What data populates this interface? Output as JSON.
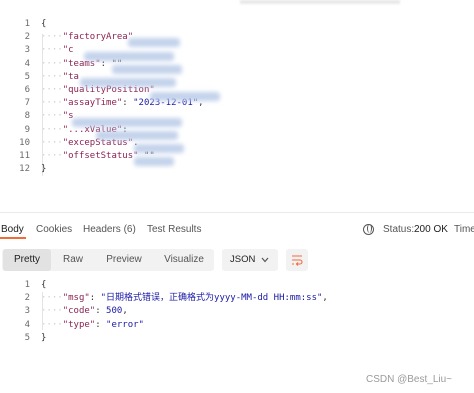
{
  "request": {
    "line_numbers": [
      "1",
      "2",
      "3",
      "4",
      "5",
      "6",
      "7",
      "8",
      "9",
      "10",
      "11",
      "12"
    ],
    "lines": [
      {
        "parts": [
          {
            "t": "p",
            "v": "{"
          }
        ]
      },
      {
        "parts": [
          {
            "t": "k",
            "v": "\"factoryArea\""
          }
        ]
      },
      {
        "parts": [
          {
            "t": "k",
            "v": "\"c"
          }
        ]
      },
      {
        "parts": [
          {
            "t": "k",
            "v": "\"teams\""
          },
          {
            "t": "p",
            "v": ": \"\""
          }
        ]
      },
      {
        "parts": [
          {
            "t": "k",
            "v": "\"ta"
          }
        ]
      },
      {
        "parts": [
          {
            "t": "k",
            "v": "\"qualityPosition\""
          }
        ]
      },
      {
        "parts": [
          {
            "t": "k",
            "v": "\"assayTime\""
          },
          {
            "t": "p",
            "v": ": "
          },
          {
            "t": "s",
            "v": "\"2023-12-01\""
          },
          {
            "t": "p",
            "v": ","
          }
        ]
      },
      {
        "parts": [
          {
            "t": "k",
            "v": "\"s"
          }
        ]
      },
      {
        "parts": [
          {
            "t": "k",
            "v": "\"...xValue\""
          },
          {
            "t": "p",
            "v": ": "
          }
        ]
      },
      {
        "parts": [
          {
            "t": "k",
            "v": "\"excepStatus\""
          },
          {
            "t": "p",
            "v": "."
          }
        ]
      },
      {
        "parts": [
          {
            "t": "k",
            "v": "\"offsetStatus\""
          },
          {
            "t": "p",
            "v": " \"\""
          }
        ]
      },
      {
        "parts": [
          {
            "t": "p",
            "v": "}"
          }
        ]
      }
    ]
  },
  "tabs": {
    "body": "Body",
    "cookies": "Cookies",
    "headers": "Headers",
    "headers_count": "(6)",
    "test_results": "Test Results"
  },
  "status": {
    "label": "Status:",
    "value": "200 OK",
    "time_label": "Time"
  },
  "toolbar": {
    "pretty": "Pretty",
    "raw": "Raw",
    "preview": "Preview",
    "visualize": "Visualize",
    "format": "JSON"
  },
  "response": {
    "line_numbers": [
      "1",
      "2",
      "3",
      "4",
      "5"
    ],
    "lines": [
      {
        "parts": [
          {
            "t": "p",
            "v": "{"
          }
        ]
      },
      {
        "parts": [
          {
            "t": "k",
            "v": "\"msg\""
          },
          {
            "t": "p",
            "v": ": "
          },
          {
            "t": "s",
            "v": "\"日期格式错误，正确格式为yyyy-MM-dd HH:mm:ss\""
          },
          {
            "t": "p",
            "v": ","
          }
        ]
      },
      {
        "parts": [
          {
            "t": "k",
            "v": "\"code\""
          },
          {
            "t": "p",
            "v": ": "
          },
          {
            "t": "s",
            "v": "500"
          },
          {
            "t": "p",
            "v": ","
          }
        ]
      },
      {
        "parts": [
          {
            "t": "k",
            "v": "\"type\""
          },
          {
            "t": "p",
            "v": ": "
          },
          {
            "t": "s",
            "v": "\"error\""
          }
        ]
      },
      {
        "parts": [
          {
            "t": "p",
            "v": "}"
          }
        ]
      }
    ]
  },
  "watermark": "CSDN @Best_Liu~",
  "colors": {
    "accent": "#f26b3a",
    "status_ok": "#0f8a4f",
    "key": "#8b2252",
    "string": "#1a1aa6"
  }
}
